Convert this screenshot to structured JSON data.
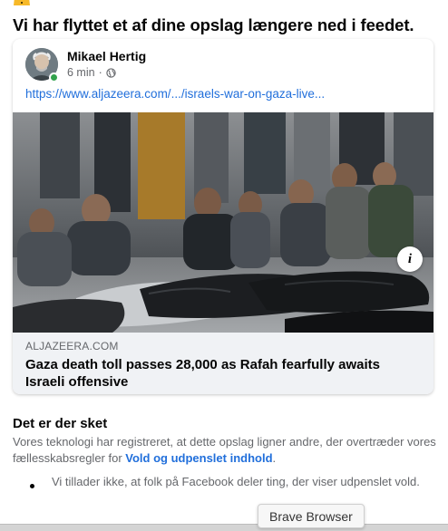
{
  "notice": {
    "icon": "warning-icon",
    "heading": "Vi har flyttet et af dine opslag længere ned i feedet."
  },
  "post": {
    "author_name": "Mikael Hertig",
    "time": "6 min",
    "separator": "·",
    "audience_icon": "globe-icon",
    "online": true,
    "link_text": "https://www.aljazeera.com/.../israels-war-on-gaza-live...",
    "preview": {
      "image_icon": "news-photo",
      "domain": "ALJAZEERA.COM",
      "title": "Gaza death toll passes 28,000 as Rafah fearfully awaits Israeli offensive",
      "info_label": "i"
    }
  },
  "explanation": {
    "title": "Det er der sket",
    "text_before_link": "Vores teknologi har registreret, at dette opslag ligner andre, der overtræder vores fællesskabsregler for ",
    "link_text": "Vold og udpenslet indhold",
    "text_after_link": ".",
    "bullets": [
      "Vi tillader ikke, at folk på Facebook deler ting, der viser udpenslet vold."
    ]
  },
  "tooltip": {
    "text": "Brave Browser"
  },
  "colors": {
    "link": "#216fdb",
    "secondary_text": "#65676b",
    "footer_bg": "#f0f2f5",
    "online": "#31a24c",
    "warning": "#f7b928"
  }
}
